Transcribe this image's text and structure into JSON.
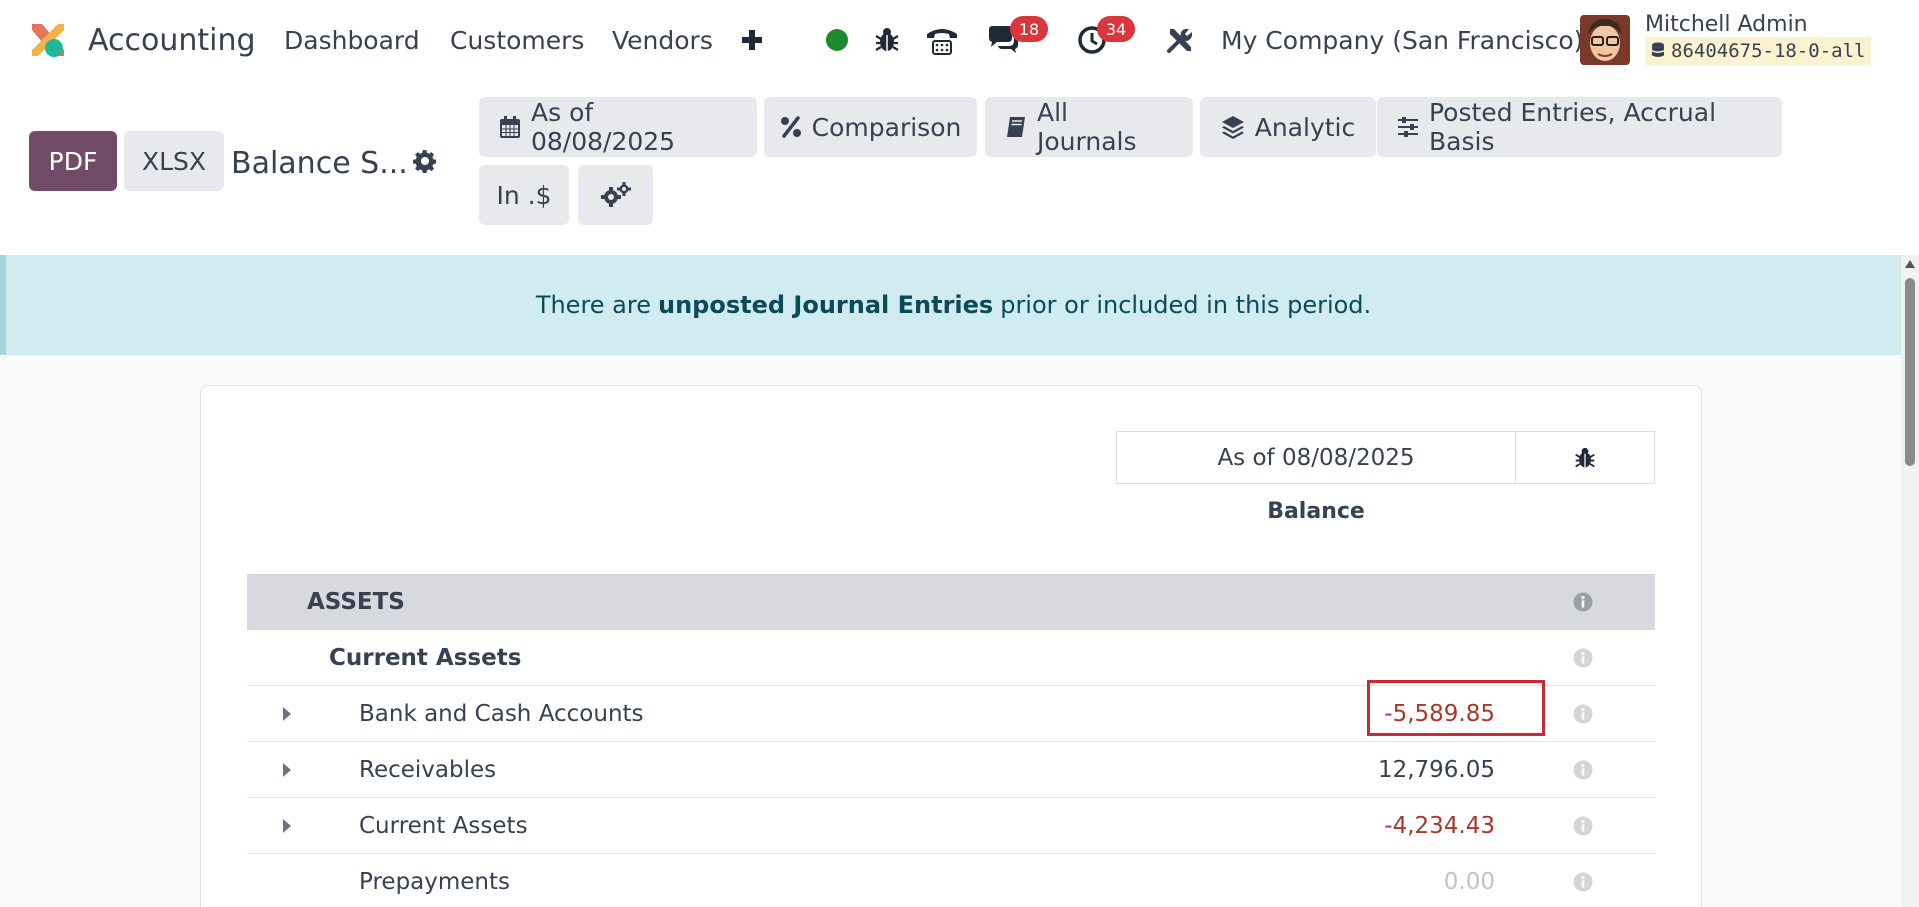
{
  "navbar": {
    "app_name": "Accounting",
    "menu": [
      "Dashboard",
      "Customers",
      "Vendors"
    ],
    "messages_count": "18",
    "activities_count": "34",
    "company": "My Company (San Francisco)",
    "user_name": "Mitchell Admin",
    "database": "86404675-18-0-all",
    "status_color": "#1e8a2d",
    "icons": [
      "plus-icon",
      "bug-icon",
      "phone-icon",
      "chat-icon",
      "clock-icon",
      "tools-icon",
      "database-icon"
    ]
  },
  "control": {
    "pdf_label": "PDF",
    "xlsx_label": "XLSX",
    "title": "Balance S...",
    "filters": {
      "date": "As of 08/08/2025",
      "comparison": "Comparison",
      "journals": "All Journals",
      "analytic": "Analytic",
      "options": "Posted Entries, Accrual Basis",
      "currency": "In .$"
    }
  },
  "alert": {
    "prefix": "There are",
    "bold": "unposted Journal Entries",
    "suffix": "prior or included in this period."
  },
  "report": {
    "column_date": "As of 08/08/2025",
    "column_label": "Balance",
    "rows": [
      {
        "label": "ASSETS",
        "kind": "section",
        "value": ""
      },
      {
        "label": "Current Assets",
        "kind": "group",
        "value": ""
      },
      {
        "label": "Bank and Cash Accounts",
        "kind": "line",
        "value": "-5,589.85",
        "expandable": true,
        "highlighted": true
      },
      {
        "label": "Receivables",
        "kind": "line",
        "value": "12,796.05",
        "expandable": true
      },
      {
        "label": "Current Assets",
        "kind": "line",
        "value": "-4,234.43",
        "expandable": true
      },
      {
        "label": "Prepayments",
        "kind": "line",
        "value": "0.00",
        "expandable": false
      }
    ]
  },
  "colors": {
    "brand": "#714b67",
    "negative": "#a8372e",
    "alert_bg": "#d1ecf1",
    "badge": "#d9363e",
    "highlight": "#cc2936"
  }
}
